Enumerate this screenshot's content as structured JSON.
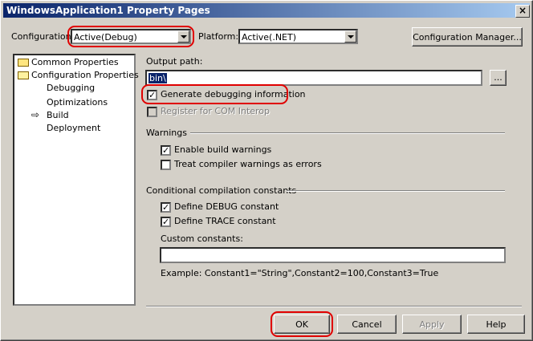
{
  "window": {
    "title": "WindowsApplication1 Property Pages",
    "close_glyph": "×"
  },
  "toolbar": {
    "configuration_label": "Configuration:",
    "configuration_value": "Active(Debug)",
    "platform_label": "Platform:",
    "platform_value": "Active(.NET)",
    "config_manager_label": "Configuration Manager..."
  },
  "tree": {
    "items": [
      {
        "label": "Common Properties"
      },
      {
        "label": "Configuration Properties"
      },
      {
        "label": "Debugging"
      },
      {
        "label": "Optimizations"
      },
      {
        "label": "Build"
      },
      {
        "label": "Deployment"
      }
    ],
    "selected_marker": "⇨"
  },
  "build": {
    "output_path_label": "Output path:",
    "output_path_value": "bin\\",
    "browse_label": "...",
    "generate_debug_label": "Generate debugging information",
    "generate_debug_checked": true,
    "register_com_label": "Register for COM Interop",
    "register_com_checked": false,
    "warnings_header": "Warnings",
    "enable_warnings_label": "Enable build warnings",
    "enable_warnings_checked": true,
    "treat_warnings_label": "Treat compiler warnings as errors",
    "treat_warnings_checked": false,
    "constants_header": "Conditional compilation constants",
    "define_debug_label": "Define DEBUG constant",
    "define_debug_checked": true,
    "define_trace_label": "Define TRACE constant",
    "define_trace_checked": true,
    "custom_constants_label": "Custom constants:",
    "custom_constants_value": "",
    "example_text": "Example: Constant1=\"String\",Constant2=100,Constant3=True"
  },
  "buttons": {
    "ok": "OK",
    "cancel": "Cancel",
    "apply": "Apply",
    "help": "Help"
  },
  "colors": {
    "highlight_ring": "#e00000",
    "titlebar": "#0a246a",
    "face": "#d4d0c8"
  }
}
